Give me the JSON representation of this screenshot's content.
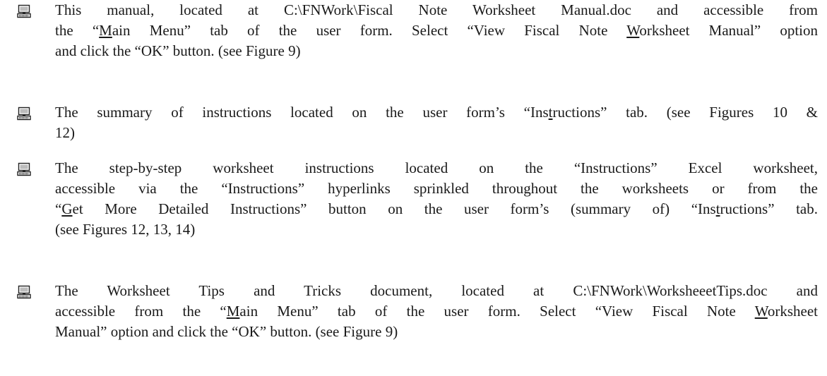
{
  "bullet_icon": "computer-icon",
  "items": [
    {
      "lines": [
        [
          {
            "t": "This manual, located at C:\\FNWork\\Fiscal Note Worksheet Manual.doc and accessible from"
          }
        ],
        [
          {
            "t": "the “"
          },
          {
            "t": "M",
            "u": true
          },
          {
            "t": "ain Menu” tab of the user form. Select “View Fiscal Note "
          },
          {
            "t": "W",
            "u": true
          },
          {
            "t": "orksheet Manual” option"
          }
        ],
        [
          {
            "t": "and click the “OK”  button. (see Figure 9)"
          }
        ]
      ]
    },
    {
      "lines": [
        [
          {
            "t": "The summary of instructions located on the user form’s “Ins"
          },
          {
            "t": "t",
            "u": true
          },
          {
            "t": "ructions” tab. (see Figures 10 &"
          }
        ],
        [
          {
            "t": "12)"
          }
        ]
      ]
    },
    {
      "lines": [
        [
          {
            "t": "The step-by-step worksheet instructions located on the “Instructions” Excel worksheet,"
          }
        ],
        [
          {
            "t": "accessible via the “Instructions” hyperlinks sprinkled throughout the worksheets or from the"
          }
        ],
        [
          {
            "t": "“"
          },
          {
            "t": "G",
            "u": true
          },
          {
            "t": "et More Detailed Instructions” button on the user form’s (summary of) “Ins"
          },
          {
            "t": "t",
            "u": true
          },
          {
            "t": "ructions” tab."
          }
        ],
        [
          {
            "t": "(see Figures 12, 13, 14)"
          }
        ]
      ]
    },
    {
      "lines": [
        [
          {
            "t": "The Worksheet Tips and Tricks document, located at C:\\FNWork\\WorksheeetTips.doc and"
          }
        ],
        [
          {
            "t": "accessible from the “"
          },
          {
            "t": "M",
            "u": true
          },
          {
            "t": "ain Menu” tab of the user form. Select “View Fiscal Note "
          },
          {
            "t": "W",
            "u": true
          },
          {
            "t": "orksheet"
          }
        ],
        [
          {
            "t": "Manual” option and click the “OK”  button. (see Figure 9)"
          }
        ]
      ]
    }
  ]
}
